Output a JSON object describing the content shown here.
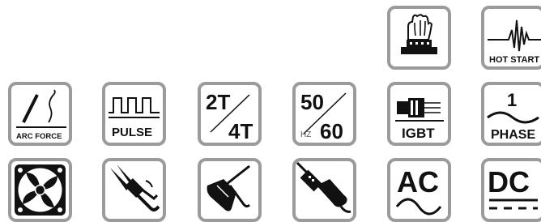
{
  "tiles": {
    "hand_protection": {
      "icon": "hand-on-hotplate-icon"
    },
    "hot_start": {
      "icon": "hot-start-waveform-icon",
      "label": "HOT START"
    },
    "arc_force": {
      "icon": "arc-force-icon",
      "label": "ARC FORCE"
    },
    "pulse": {
      "icon": "pulse-waveform-icon",
      "label": "PULSE"
    },
    "trigger_mode": {
      "icon": "2t-4t-icon",
      "top": "2T",
      "bottom": "4T"
    },
    "frequency": {
      "icon": "50-60hz-icon",
      "top": "50",
      "unit": "HZ",
      "bottom": "60"
    },
    "igbt": {
      "icon": "igbt-module-icon",
      "label": "IGBT"
    },
    "phase": {
      "icon": "single-phase-icon",
      "number": "1",
      "label": "PHASE"
    },
    "fan": {
      "icon": "cooling-fan-icon"
    },
    "ground_clamp": {
      "icon": "ground-clamp-icon"
    },
    "electrode_holder": {
      "icon": "electrode-holder-icon"
    },
    "tig_torch": {
      "icon": "tig-torch-icon"
    },
    "ac": {
      "icon": "ac-sine-icon",
      "label": "AC"
    },
    "dc": {
      "icon": "dc-icon",
      "label": "DC"
    }
  },
  "colors": {
    "border": "#9b9b9b",
    "ink": "#111111"
  }
}
